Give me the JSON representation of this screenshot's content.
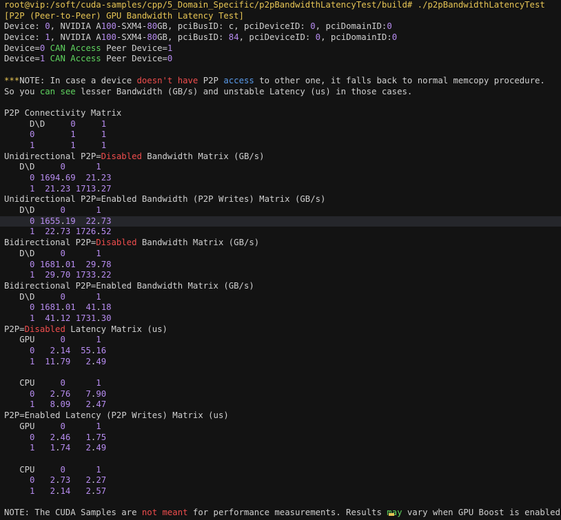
{
  "terminal": {
    "lines": [
      [
        {
          "t": "root@vip:/soft/cuda-samples/cpp/5_Domain_Specific/p2pBandwidthLatencyTest/build# ./p2pBandwidthLatencyTest",
          "c": "y"
        }
      ],
      [
        {
          "t": "[P2P (Peer-to-Peer) GPU Bandwidth Latency Test]",
          "c": "y"
        }
      ],
      [
        {
          "t": "Device: ",
          "c": "w"
        },
        {
          "t": "0",
          "c": "p"
        },
        {
          "t": ", NVIDIA A",
          "c": "w"
        },
        {
          "t": "100",
          "c": "p"
        },
        {
          "t": "-SXM4-",
          "c": "w"
        },
        {
          "t": "80",
          "c": "p"
        },
        {
          "t": "GB, pciBusID: c, pciDeviceID: ",
          "c": "w"
        },
        {
          "t": "0",
          "c": "p"
        },
        {
          "t": ", pciDomainID:",
          "c": "w"
        },
        {
          "t": "0",
          "c": "p"
        }
      ],
      [
        {
          "t": "Device: ",
          "c": "w"
        },
        {
          "t": "1",
          "c": "p"
        },
        {
          "t": ", NVIDIA A",
          "c": "w"
        },
        {
          "t": "100",
          "c": "p"
        },
        {
          "t": "-SXM4-",
          "c": "w"
        },
        {
          "t": "80",
          "c": "p"
        },
        {
          "t": "GB, pciBusID: ",
          "c": "w"
        },
        {
          "t": "84",
          "c": "p"
        },
        {
          "t": ", pciDeviceID: ",
          "c": "w"
        },
        {
          "t": "0",
          "c": "p"
        },
        {
          "t": ", pciDomainID:",
          "c": "w"
        },
        {
          "t": "0",
          "c": "p"
        }
      ],
      [
        {
          "t": "Device=",
          "c": "w"
        },
        {
          "t": "0",
          "c": "p"
        },
        {
          "t": " CAN Access",
          "c": "g"
        },
        {
          "t": " Peer Device=",
          "c": "w"
        },
        {
          "t": "1",
          "c": "p"
        }
      ],
      [
        {
          "t": "Device=",
          "c": "w"
        },
        {
          "t": "1",
          "c": "p"
        },
        {
          "t": " CAN Access",
          "c": "g"
        },
        {
          "t": " Peer Device=",
          "c": "w"
        },
        {
          "t": "0",
          "c": "p"
        }
      ],
      [
        {
          "t": "",
          "c": "w"
        }
      ],
      [
        {
          "t": "***",
          "c": "y"
        },
        {
          "t": "NOTE: In case a device ",
          "c": "w"
        },
        {
          "t": "doesn't have",
          "c": "r"
        },
        {
          "t": " P2P ",
          "c": "w"
        },
        {
          "t": "access",
          "c": "b"
        },
        {
          "t": " to other one, it falls back to normal memcopy procedure.",
          "c": "w"
        }
      ],
      [
        {
          "t": "So you ",
          "c": "w"
        },
        {
          "t": "can see",
          "c": "g"
        },
        {
          "t": " lesser Bandwidth (GB/s) and unstable Latency (us) in those cases.",
          "c": "w"
        }
      ],
      [
        {
          "t": "",
          "c": "w"
        }
      ],
      [
        {
          "t": "P2P Connectivity Matrix",
          "c": "w"
        }
      ],
      [
        {
          "t": "     D\\D     ",
          "c": "w"
        },
        {
          "t": "0",
          "c": "p"
        },
        {
          "t": "     ",
          "c": "w"
        },
        {
          "t": "1",
          "c": "p"
        }
      ],
      [
        {
          "t": "     ",
          "c": "w"
        },
        {
          "t": "0",
          "c": "p"
        },
        {
          "t": "       ",
          "c": "w"
        },
        {
          "t": "1",
          "c": "p"
        },
        {
          "t": "     ",
          "c": "w"
        },
        {
          "t": "1",
          "c": "p"
        }
      ],
      [
        {
          "t": "     ",
          "c": "w"
        },
        {
          "t": "1",
          "c": "p"
        },
        {
          "t": "       ",
          "c": "w"
        },
        {
          "t": "1",
          "c": "p"
        },
        {
          "t": "     ",
          "c": "w"
        },
        {
          "t": "1",
          "c": "p"
        }
      ],
      [
        {
          "t": "Unidirectional P2P=",
          "c": "w"
        },
        {
          "t": "Disabled",
          "c": "r"
        },
        {
          "t": " Bandwidth Matrix (GB/s)",
          "c": "w"
        }
      ],
      [
        {
          "t": "   D\\D     ",
          "c": "w"
        },
        {
          "t": "0",
          "c": "p"
        },
        {
          "t": "      ",
          "c": "w"
        },
        {
          "t": "1",
          "c": "p"
        }
      ],
      [
        {
          "t": "     ",
          "c": "w"
        },
        {
          "t": "0",
          "c": "p"
        },
        {
          "t": " ",
          "c": "w"
        },
        {
          "t": "1694",
          "c": "p"
        },
        {
          "t": ".",
          "c": "w"
        },
        {
          "t": "69",
          "c": "p"
        },
        {
          "t": "  ",
          "c": "w"
        },
        {
          "t": "21",
          "c": "p"
        },
        {
          "t": ".",
          "c": "w"
        },
        {
          "t": "23",
          "c": "p"
        }
      ],
      [
        {
          "t": "     ",
          "c": "w"
        },
        {
          "t": "1",
          "c": "p"
        },
        {
          "t": "  ",
          "c": "w"
        },
        {
          "t": "21",
          "c": "p"
        },
        {
          "t": ".",
          "c": "w"
        },
        {
          "t": "23",
          "c": "p"
        },
        {
          "t": " ",
          "c": "w"
        },
        {
          "t": "1713",
          "c": "p"
        },
        {
          "t": ".",
          "c": "w"
        },
        {
          "t": "27",
          "c": "p"
        }
      ],
      [
        {
          "t": "Unidirectional P2P=Enabled Bandwidth (P2P Writes) Matrix (GB/s)",
          "c": "w"
        }
      ],
      [
        {
          "t": "   D\\D     ",
          "c": "w"
        },
        {
          "t": "0",
          "c": "p"
        },
        {
          "t": "      ",
          "c": "w"
        },
        {
          "t": "1",
          "c": "p"
        }
      ],
      [
        {
          "t": "     ",
          "c": "w"
        },
        {
          "t": "0",
          "c": "p"
        },
        {
          "t": " ",
          "c": "w"
        },
        {
          "t": "1655",
          "c": "p"
        },
        {
          "t": ".",
          "c": "w"
        },
        {
          "t": "19",
          "c": "p"
        },
        {
          "t": "  ",
          "c": "w"
        },
        {
          "t": "22",
          "c": "p"
        },
        {
          "t": ".",
          "c": "w"
        },
        {
          "t": "73",
          "c": "p"
        }
      ],
      [
        {
          "t": "     ",
          "c": "w"
        },
        {
          "t": "1",
          "c": "p"
        },
        {
          "t": "  ",
          "c": "w"
        },
        {
          "t": "22",
          "c": "p"
        },
        {
          "t": ".",
          "c": "w"
        },
        {
          "t": "73",
          "c": "p"
        },
        {
          "t": " ",
          "c": "w"
        },
        {
          "t": "1726",
          "c": "p"
        },
        {
          "t": ".",
          "c": "w"
        },
        {
          "t": "52",
          "c": "p"
        }
      ],
      [
        {
          "t": "Bidirectional P2P=",
          "c": "w"
        },
        {
          "t": "Disabled",
          "c": "r"
        },
        {
          "t": " Bandwidth Matrix (GB/s)",
          "c": "w"
        }
      ],
      [
        {
          "t": "   D\\D     ",
          "c": "w"
        },
        {
          "t": "0",
          "c": "p"
        },
        {
          "t": "      ",
          "c": "w"
        },
        {
          "t": "1",
          "c": "p"
        }
      ],
      [
        {
          "t": "     ",
          "c": "w"
        },
        {
          "t": "0",
          "c": "p"
        },
        {
          "t": " ",
          "c": "w"
        },
        {
          "t": "1681",
          "c": "p"
        },
        {
          "t": ".",
          "c": "w"
        },
        {
          "t": "01",
          "c": "p"
        },
        {
          "t": "  ",
          "c": "w"
        },
        {
          "t": "29",
          "c": "p"
        },
        {
          "t": ".",
          "c": "w"
        },
        {
          "t": "78",
          "c": "p"
        }
      ],
      [
        {
          "t": "     ",
          "c": "w"
        },
        {
          "t": "1",
          "c": "p"
        },
        {
          "t": "  ",
          "c": "w"
        },
        {
          "t": "29",
          "c": "p"
        },
        {
          "t": ".",
          "c": "w"
        },
        {
          "t": "70",
          "c": "p"
        },
        {
          "t": " ",
          "c": "w"
        },
        {
          "t": "1733",
          "c": "p"
        },
        {
          "t": ".",
          "c": "w"
        },
        {
          "t": "22",
          "c": "p"
        }
      ],
      [
        {
          "t": "Bidirectional P2P=Enabled Bandwidth Matrix (GB/s)",
          "c": "w"
        }
      ],
      [
        {
          "t": "   D\\D     ",
          "c": "w"
        },
        {
          "t": "0",
          "c": "p"
        },
        {
          "t": "      ",
          "c": "w"
        },
        {
          "t": "1",
          "c": "p"
        }
      ],
      [
        {
          "t": "     ",
          "c": "w"
        },
        {
          "t": "0",
          "c": "p"
        },
        {
          "t": " ",
          "c": "w"
        },
        {
          "t": "1681",
          "c": "p"
        },
        {
          "t": ".",
          "c": "w"
        },
        {
          "t": "01",
          "c": "p"
        },
        {
          "t": "  ",
          "c": "w"
        },
        {
          "t": "41",
          "c": "p"
        },
        {
          "t": ".",
          "c": "w"
        },
        {
          "t": "18",
          "c": "p"
        }
      ],
      [
        {
          "t": "     ",
          "c": "w"
        },
        {
          "t": "1",
          "c": "p"
        },
        {
          "t": "  ",
          "c": "w"
        },
        {
          "t": "41",
          "c": "p"
        },
        {
          "t": ".",
          "c": "w"
        },
        {
          "t": "12",
          "c": "p"
        },
        {
          "t": " ",
          "c": "w"
        },
        {
          "t": "1731",
          "c": "p"
        },
        {
          "t": ".",
          "c": "w"
        },
        {
          "t": "30",
          "c": "p"
        }
      ],
      [
        {
          "t": "P2P=",
          "c": "w"
        },
        {
          "t": "Disabled",
          "c": "r"
        },
        {
          "t": " Latency Matrix (us)",
          "c": "w"
        }
      ],
      [
        {
          "t": "   GPU     ",
          "c": "w"
        },
        {
          "t": "0",
          "c": "p"
        },
        {
          "t": "      ",
          "c": "w"
        },
        {
          "t": "1",
          "c": "p"
        }
      ],
      [
        {
          "t": "     ",
          "c": "w"
        },
        {
          "t": "0",
          "c": "p"
        },
        {
          "t": "   ",
          "c": "w"
        },
        {
          "t": "2",
          "c": "p"
        },
        {
          "t": ".",
          "c": "w"
        },
        {
          "t": "14",
          "c": "p"
        },
        {
          "t": "  ",
          "c": "w"
        },
        {
          "t": "55",
          "c": "p"
        },
        {
          "t": ".",
          "c": "w"
        },
        {
          "t": "16",
          "c": "p"
        }
      ],
      [
        {
          "t": "     ",
          "c": "w"
        },
        {
          "t": "1",
          "c": "p"
        },
        {
          "t": "  ",
          "c": "w"
        },
        {
          "t": "11",
          "c": "p"
        },
        {
          "t": ".",
          "c": "w"
        },
        {
          "t": "79",
          "c": "p"
        },
        {
          "t": "   ",
          "c": "w"
        },
        {
          "t": "2",
          "c": "p"
        },
        {
          "t": ".",
          "c": "w"
        },
        {
          "t": "49",
          "c": "p"
        }
      ],
      [
        {
          "t": "",
          "c": "w"
        }
      ],
      [
        {
          "t": "   CPU     ",
          "c": "w"
        },
        {
          "t": "0",
          "c": "p"
        },
        {
          "t": "      ",
          "c": "w"
        },
        {
          "t": "1",
          "c": "p"
        }
      ],
      [
        {
          "t": "     ",
          "c": "w"
        },
        {
          "t": "0",
          "c": "p"
        },
        {
          "t": "   ",
          "c": "w"
        },
        {
          "t": "2",
          "c": "p"
        },
        {
          "t": ".",
          "c": "w"
        },
        {
          "t": "76",
          "c": "p"
        },
        {
          "t": "   ",
          "c": "w"
        },
        {
          "t": "7",
          "c": "p"
        },
        {
          "t": ".",
          "c": "w"
        },
        {
          "t": "90",
          "c": "p"
        }
      ],
      [
        {
          "t": "     ",
          "c": "w"
        },
        {
          "t": "1",
          "c": "p"
        },
        {
          "t": "   ",
          "c": "w"
        },
        {
          "t": "8",
          "c": "p"
        },
        {
          "t": ".",
          "c": "w"
        },
        {
          "t": "09",
          "c": "p"
        },
        {
          "t": "   ",
          "c": "w"
        },
        {
          "t": "2",
          "c": "p"
        },
        {
          "t": ".",
          "c": "w"
        },
        {
          "t": "47",
          "c": "p"
        }
      ],
      [
        {
          "t": "P2P=Enabled Latency (P2P Writes) Matrix (us)",
          "c": "w"
        }
      ],
      [
        {
          "t": "   GPU     ",
          "c": "w"
        },
        {
          "t": "0",
          "c": "p"
        },
        {
          "t": "      ",
          "c": "w"
        },
        {
          "t": "1",
          "c": "p"
        }
      ],
      [
        {
          "t": "     ",
          "c": "w"
        },
        {
          "t": "0",
          "c": "p"
        },
        {
          "t": "   ",
          "c": "w"
        },
        {
          "t": "2",
          "c": "p"
        },
        {
          "t": ".",
          "c": "w"
        },
        {
          "t": "46",
          "c": "p"
        },
        {
          "t": "   ",
          "c": "w"
        },
        {
          "t": "1",
          "c": "p"
        },
        {
          "t": ".",
          "c": "w"
        },
        {
          "t": "75",
          "c": "p"
        }
      ],
      [
        {
          "t": "     ",
          "c": "w"
        },
        {
          "t": "1",
          "c": "p"
        },
        {
          "t": "   ",
          "c": "w"
        },
        {
          "t": "1",
          "c": "p"
        },
        {
          "t": ".",
          "c": "w"
        },
        {
          "t": "74",
          "c": "p"
        },
        {
          "t": "   ",
          "c": "w"
        },
        {
          "t": "2",
          "c": "p"
        },
        {
          "t": ".",
          "c": "w"
        },
        {
          "t": "49",
          "c": "p"
        }
      ],
      [
        {
          "t": "",
          "c": "w"
        }
      ],
      [
        {
          "t": "   CPU     ",
          "c": "w"
        },
        {
          "t": "0",
          "c": "p"
        },
        {
          "t": "      ",
          "c": "w"
        },
        {
          "t": "1",
          "c": "p"
        }
      ],
      [
        {
          "t": "     ",
          "c": "w"
        },
        {
          "t": "0",
          "c": "p"
        },
        {
          "t": "   ",
          "c": "w"
        },
        {
          "t": "2",
          "c": "p"
        },
        {
          "t": ".",
          "c": "w"
        },
        {
          "t": "73",
          "c": "p"
        },
        {
          "t": "   ",
          "c": "w"
        },
        {
          "t": "2",
          "c": "p"
        },
        {
          "t": ".",
          "c": "w"
        },
        {
          "t": "27",
          "c": "p"
        }
      ],
      [
        {
          "t": "     ",
          "c": "w"
        },
        {
          "t": "1",
          "c": "p"
        },
        {
          "t": "   ",
          "c": "w"
        },
        {
          "t": "2",
          "c": "p"
        },
        {
          "t": ".",
          "c": "w"
        },
        {
          "t": "14",
          "c": "p"
        },
        {
          "t": "   ",
          "c": "w"
        },
        {
          "t": "2",
          "c": "p"
        },
        {
          "t": ".",
          "c": "w"
        },
        {
          "t": "57",
          "c": "p"
        }
      ],
      [
        {
          "t": "",
          "c": "w"
        }
      ],
      [
        {
          "t": "NOTE: The CUDA Samples are ",
          "c": "w"
        },
        {
          "t": "not meant",
          "c": "r"
        },
        {
          "t": " for performance measurements. Results ",
          "c": "w"
        },
        {
          "t": "may",
          "c": "g"
        },
        {
          "t": " vary when GPU Boost is enabled.",
          "c": "w"
        }
      ]
    ],
    "highlighted_line": 20
  },
  "colors": {
    "background": "#131313",
    "prompt": "#e6c454",
    "number": "#b78cf0",
    "negative": "#ef4d4d",
    "positive": "#5fd35f",
    "keyword": "#5a9bea",
    "text": "#d0d0d0"
  }
}
